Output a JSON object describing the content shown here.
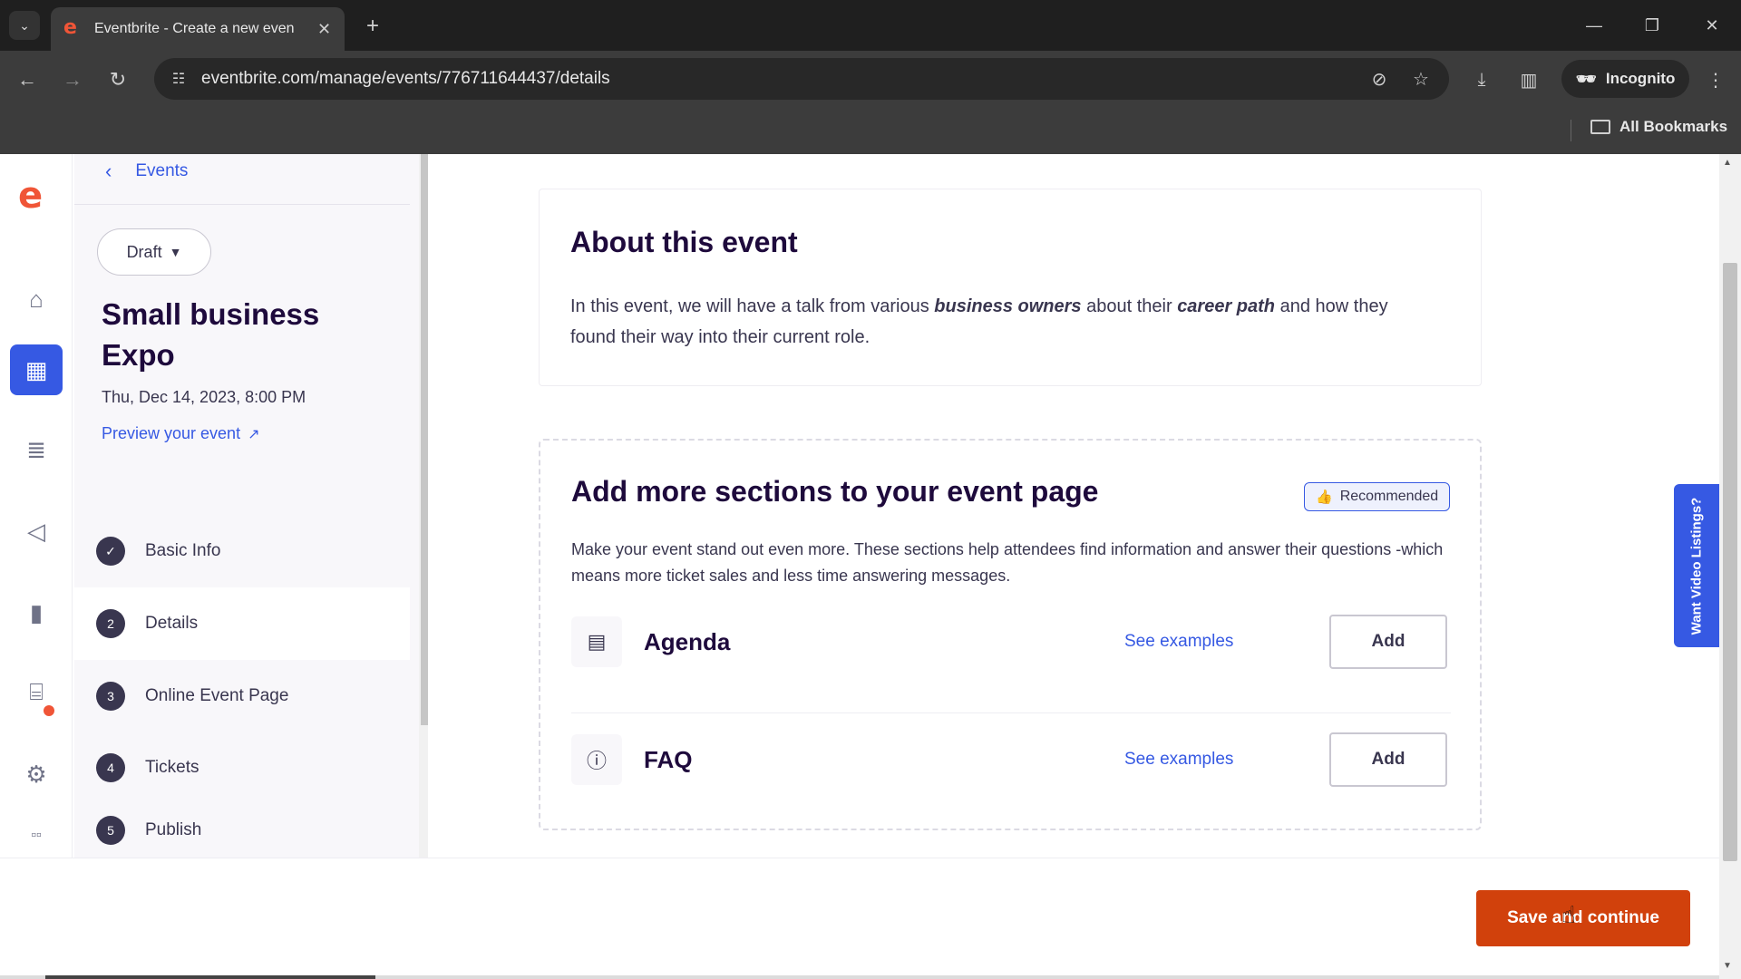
{
  "browser": {
    "tab_title": "Eventbrite - Create a new even",
    "favicon": "e",
    "url": "eventbrite.com/manage/events/776711644437/details",
    "incognito_label": "Incognito",
    "bookmarks_label": "All Bookmarks"
  },
  "rail": {
    "logo": "e",
    "items": [
      "home-icon",
      "calendar-icon",
      "orders-icon",
      "megaphone-icon",
      "chart-icon",
      "bank-icon",
      "gear-icon",
      "apps-icon"
    ]
  },
  "sidebar": {
    "back_label": "Events",
    "status": "Draft",
    "event_title": "Small business Expo",
    "event_date": "Thu, Dec 14, 2023, 8:00 PM",
    "preview_label": "Preview your event",
    "steps": [
      {
        "num": "✓",
        "label": "Basic Info"
      },
      {
        "num": "2",
        "label": "Details"
      },
      {
        "num": "3",
        "label": "Online Event Page"
      },
      {
        "num": "4",
        "label": "Tickets"
      },
      {
        "num": "5",
        "label": "Publish"
      }
    ]
  },
  "about": {
    "heading": "About this event",
    "text_1": "In this event, we will have a talk from various ",
    "bold_1": "business owners",
    "text_2": " about their ",
    "bold_2": "career path",
    "text_3": " and how they found their way into their current role."
  },
  "more_sections": {
    "heading": "Add more sections to your event page",
    "badge": "Recommended",
    "description": "Make your event stand out even more. These sections help attendees find information and answer their questions -which means more ticket sales and less time answering messages.",
    "items": [
      {
        "icon": "agenda-icon",
        "name": "Agenda",
        "examples_label": "See examples",
        "add_label": "Add"
      },
      {
        "icon": "faq-icon",
        "name": "FAQ",
        "examples_label": "See examples",
        "add_label": "Add"
      }
    ]
  },
  "video_tab": "Want Video Listings?",
  "save_button": "Save and continue",
  "colors": {
    "brand": "#f05537",
    "accent": "#3659e3",
    "save": "#d1410c"
  }
}
